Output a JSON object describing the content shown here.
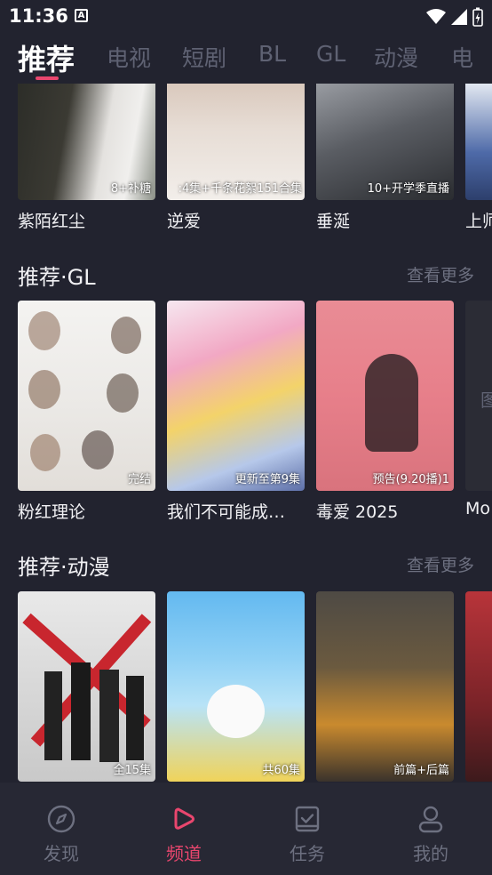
{
  "status_bar": {
    "time": "11:36",
    "app_icon_letter": "A"
  },
  "tabs": [
    {
      "label": "推荐",
      "active": true
    },
    {
      "label": "电视"
    },
    {
      "label": "短剧"
    },
    {
      "label": "BL"
    },
    {
      "label": "GL"
    },
    {
      "label": "动漫"
    },
    {
      "label": "电"
    }
  ],
  "row_top": {
    "cards": [
      {
        "title": "紫陌红尘",
        "badge": "8+补糖"
      },
      {
        "title": "逆爱",
        "badge": ":4集+千条花絮151合集"
      },
      {
        "title": "垂涎",
        "badge": "10+开学季直播"
      },
      {
        "title": "上师",
        "badge": ""
      }
    ]
  },
  "section_gl": {
    "title": "推荐·GL",
    "more": "查看更多",
    "cards": [
      {
        "title": "粉红理论",
        "badge": "完结"
      },
      {
        "title": "我们不可能成…",
        "badge": "更新至第9集"
      },
      {
        "title": "毒爱 2025",
        "badge": "预告(9.20播)1"
      },
      {
        "title": "Mo",
        "badge": ""
      }
    ]
  },
  "section_anime": {
    "title": "推荐·动漫",
    "more": "查看更多",
    "cards": [
      {
        "title": "",
        "badge": "全15集"
      },
      {
        "title": "",
        "badge": "共60集"
      },
      {
        "title": "",
        "badge": "前篇+后篇"
      },
      {
        "title": "",
        "badge": ""
      }
    ]
  },
  "bottom_nav": [
    {
      "label": "发现",
      "icon": "compass-icon"
    },
    {
      "label": "频道",
      "icon": "play-icon",
      "active": true
    },
    {
      "label": "任务",
      "icon": "task-icon"
    },
    {
      "label": "我的",
      "icon": "user-icon"
    }
  ],
  "colors": {
    "accent": "#e9466e",
    "background": "#22232f",
    "muted": "#6d7080"
  }
}
